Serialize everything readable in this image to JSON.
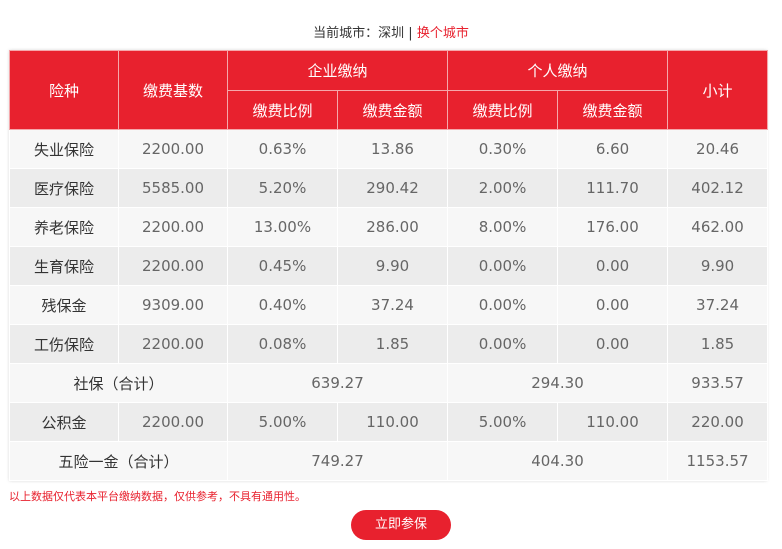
{
  "city": {
    "label": "当前城市：",
    "name": "深圳",
    "separator": " | ",
    "change_link": "换个城市"
  },
  "table": {
    "headers": {
      "type": "险种",
      "base": "缴费基数",
      "company_group": "企业缴纳",
      "personal_group": "个人缴纳",
      "subtotal": "小计",
      "company_rate": "缴费比例",
      "company_amount": "缴费金额",
      "personal_rate": "缴费比例",
      "personal_amount": "缴费金额"
    },
    "rows": [
      {
        "name": "失业保险",
        "base": "2200.00",
        "c_rate": "0.63%",
        "c_amt": "13.86",
        "p_rate": "0.30%",
        "p_amt": "6.60",
        "sub": "20.46"
      },
      {
        "name": "医疗保险",
        "base": "5585.00",
        "c_rate": "5.20%",
        "c_amt": "290.42",
        "p_rate": "2.00%",
        "p_amt": "111.70",
        "sub": "402.12"
      },
      {
        "name": "养老保险",
        "base": "2200.00",
        "c_rate": "13.00%",
        "c_amt": "286.00",
        "p_rate": "8.00%",
        "p_amt": "176.00",
        "sub": "462.00"
      },
      {
        "name": "生育保险",
        "base": "2200.00",
        "c_rate": "0.45%",
        "c_amt": "9.90",
        "p_rate": "0.00%",
        "p_amt": "0.00",
        "sub": "9.90"
      },
      {
        "name": "残保金",
        "base": "9309.00",
        "c_rate": "0.40%",
        "c_amt": "37.24",
        "p_rate": "0.00%",
        "p_amt": "0.00",
        "sub": "37.24"
      },
      {
        "name": "工伤保险",
        "base": "2200.00",
        "c_rate": "0.08%",
        "c_amt": "1.85",
        "p_rate": "0.00%",
        "p_amt": "0.00",
        "sub": "1.85"
      }
    ],
    "social_total": {
      "name": "社保（合计）",
      "company": "639.27",
      "personal": "294.30",
      "sub": "933.57"
    },
    "fund": {
      "name": "公积金",
      "base": "2200.00",
      "c_rate": "5.00%",
      "c_amt": "110.00",
      "p_rate": "5.00%",
      "p_amt": "110.00",
      "sub": "220.00"
    },
    "grand_total": {
      "name": "五险一金（合计）",
      "company": "749.27",
      "personal": "404.30",
      "sub": "1153.57"
    }
  },
  "note": "以上数据仅代表本平台缴纳数据，仅供参考，不具有通用性。",
  "button": "立即参保",
  "colors": {
    "accent": "#e8212e"
  }
}
